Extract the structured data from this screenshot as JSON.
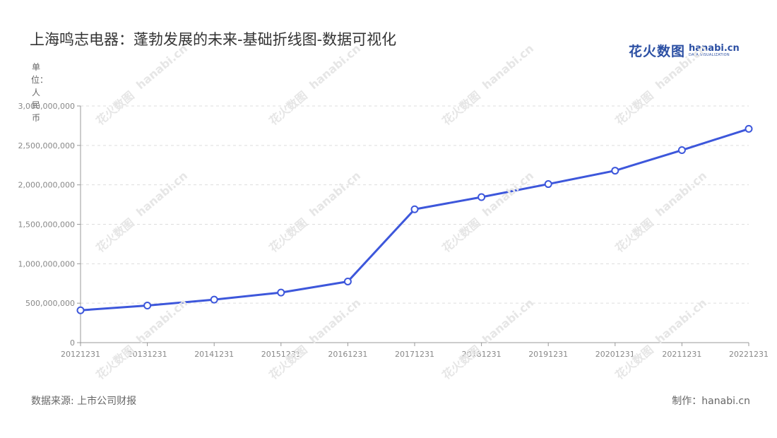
{
  "title": "上海鸣志电器：蓬勃发展的未来-基础折线图-数据可视化",
  "unit_label": "单位：人民币",
  "logo": {
    "cn": "花火数图",
    "en": "hanabi.cn",
    "sub": "DATA VISUALIZATION"
  },
  "footer": {
    "source": "数据来源: 上市公司财报",
    "credit": "制作：hanabi.cn"
  },
  "colors": {
    "line": "#3d57db",
    "grid": "#dddddd",
    "axis": "#999999",
    "tick_text": "#888888"
  },
  "chart_data": {
    "type": "line",
    "title": "上海鸣志电器：蓬勃发展的未来-基础折线图-数据可视化",
    "ylabel": "单位：人民币",
    "xlabel": "",
    "categories": [
      "20121231",
      "20131231",
      "20141231",
      "20151231",
      "20161231",
      "20171231",
      "20181231",
      "20191231",
      "20201231",
      "20211231",
      "20221231"
    ],
    "series": [
      {
        "values": [
          410000000,
          470000000,
          545000000,
          635000000,
          775000000,
          1690000000,
          1845000000,
          2010000000,
          2180000000,
          2440000000,
          2710000000
        ]
      }
    ],
    "ylim": [
      0,
      3000000000
    ],
    "yticks": [
      0,
      500000000,
      1000000000,
      1500000000,
      2000000000,
      2500000000,
      3000000000
    ],
    "ytick_labels": [
      "0",
      "500,000,000",
      "1,000,000,000",
      "1,500,000,000",
      "2,000,000,000",
      "2,500,000,000",
      "3,000,000,000"
    ],
    "grid": true,
    "legend": "none"
  }
}
